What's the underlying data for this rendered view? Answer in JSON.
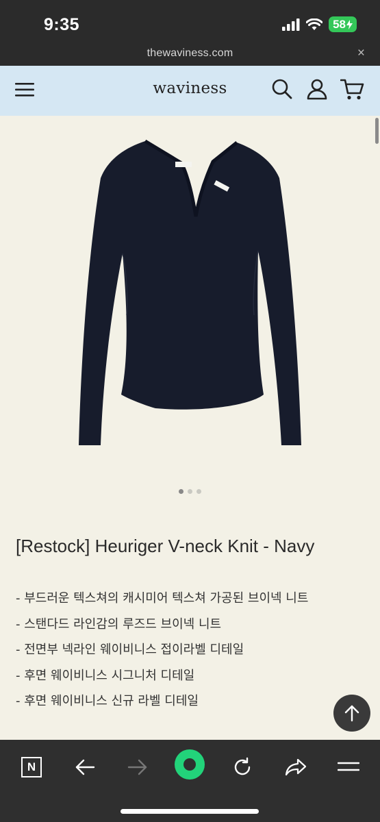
{
  "status_bar": {
    "time": "9:35",
    "battery": "58"
  },
  "browser": {
    "url": "thewaviness.com",
    "close_glyph": "×"
  },
  "site": {
    "logo": "waviness"
  },
  "carousel": {
    "total": 3,
    "active_index": 0
  },
  "product": {
    "title": "[Restock] Heuriger V-neck Knit - Navy",
    "features": [
      "- 부드러운 텍스쳐의 캐시미어 텍스쳐 가공된 브이넥 니트",
      "- 스탠다드 라인감의 루즈드 브이넥 니트",
      "- 전면부 넥라인 웨이비니스 접이라벨 디테일",
      "- 후면 웨이비니스 시그니처 디테일",
      "- 후면 웨이비니스 신규 라벨 디테일"
    ]
  },
  "toolbar": {
    "app_badge": "N"
  },
  "colors": {
    "header_bg": "#d5e7f3",
    "page_bg": "#f3f1e6",
    "accent_green": "#22d37a",
    "battery_green": "#34c759",
    "knit_navy": "#171c2c"
  }
}
